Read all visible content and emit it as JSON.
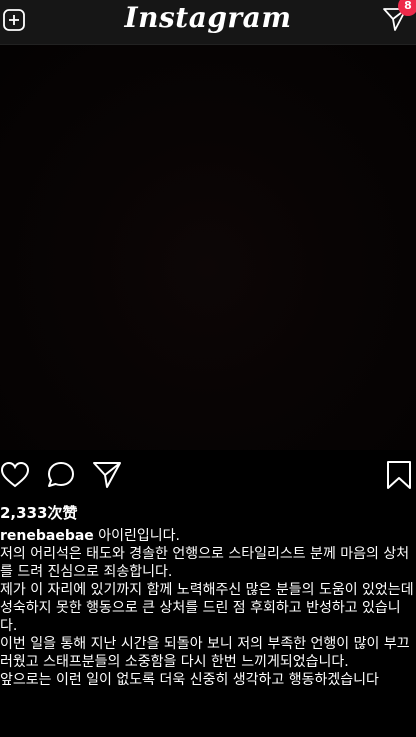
{
  "header": {
    "logo_text": "Instagram",
    "notification_count": "8"
  },
  "post": {
    "likes": "2,333次赞",
    "username": "renebaebae",
    "caption_first": "아이린입니다.",
    "paragraphs": [
      "저의 어리석은 태도와 경솔한 언행으로 스타일리스트 분께 마음의 상처를 드려 진심으로 죄송합니다.",
      "제가 이 자리에 있기까지 함께 노력해주신 많은 분들의 도움이 있었는데 성숙하지 못한 행동으로 큰 상처를 드린 점 후회하고 반성하고 있습니다.",
      "이번 일을 통해 지난 시간을 되돌아 보니 저의 부족한 언행이 많이 부끄러웠고 스태프분들의 소중함을 다시 한번 느끼게되었습니다.",
      "앞으로는 이런 일이 없도록 더욱 신중히 생각하고 행동하겠습니다"
    ]
  },
  "icons": {
    "add": "plus-square-icon",
    "send": "paper-plane-icon",
    "like": "heart-icon",
    "comment": "comment-icon",
    "share": "paper-plane-icon",
    "save": "bookmark-icon"
  },
  "colors": {
    "background": "#000000",
    "topbar": "#161616",
    "badge": "#ee2a4a"
  }
}
